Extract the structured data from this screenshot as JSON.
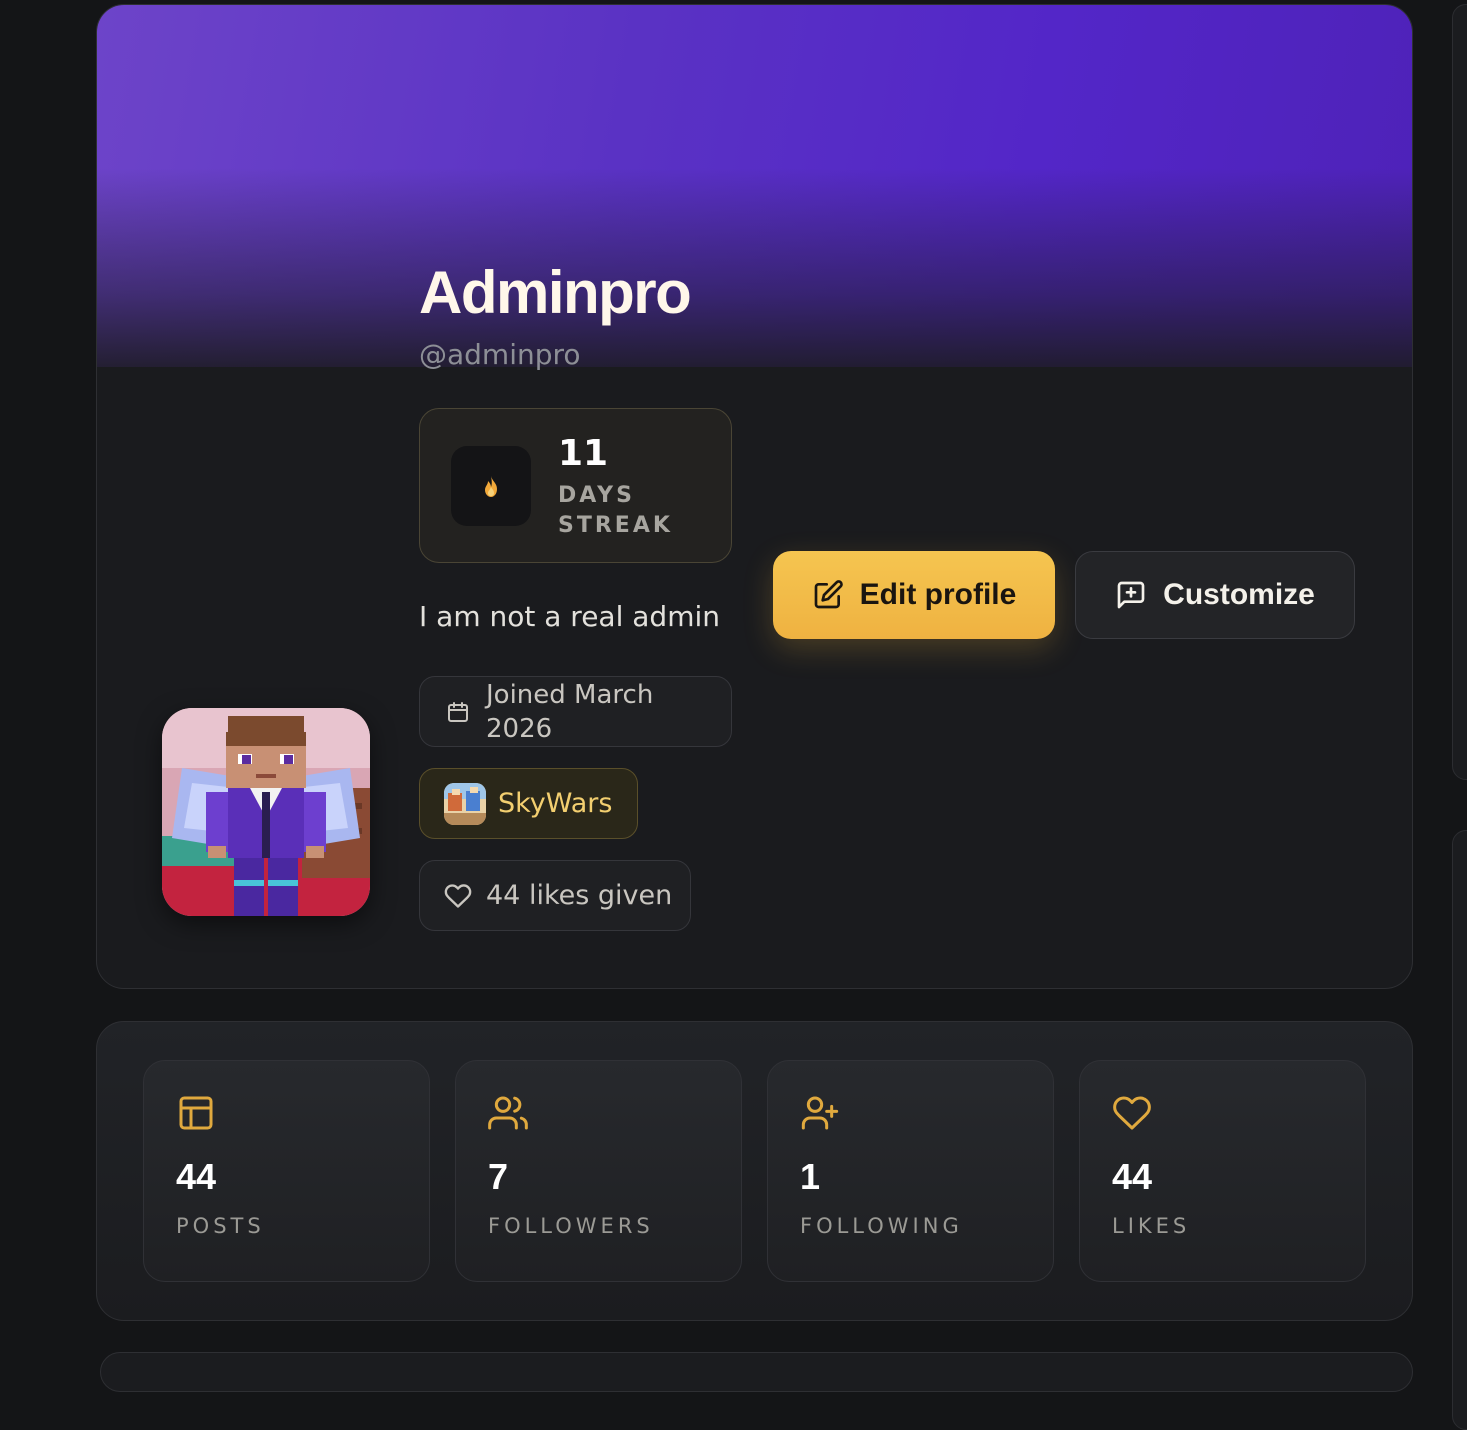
{
  "profile": {
    "display_name": "Adminpro",
    "handle": "@adminpro",
    "bio": "I am not a real admin",
    "streak": {
      "count": "11",
      "label": "DAYS STREAK",
      "icon": "flame-icon"
    },
    "joined": {
      "icon": "calendar-icon",
      "text": "Joined March 2026"
    },
    "favorite_game": {
      "icon": "skywars-thumbnail",
      "name": "SkyWars"
    },
    "likes_given": {
      "icon": "heart-icon",
      "text": "44 likes given"
    },
    "avatar": "minecraft-character-avatar"
  },
  "actions": {
    "edit_label": "Edit profile",
    "edit_icon": "edit-icon",
    "customize_label": "Customize",
    "customize_icon": "message-plus-icon"
  },
  "stats": [
    {
      "icon": "layout-icon",
      "value": "44",
      "label": "POSTS"
    },
    {
      "icon": "users-icon",
      "value": "7",
      "label": "FOLLOWERS"
    },
    {
      "icon": "user-plus-icon",
      "value": "1",
      "label": "FOLLOWING"
    },
    {
      "icon": "heart-icon",
      "value": "44",
      "label": "LIKES"
    }
  ],
  "colors": {
    "accent": "#f3b843",
    "banner": "#5a30c6",
    "background": "#141517",
    "card": "#1a1b1e"
  }
}
